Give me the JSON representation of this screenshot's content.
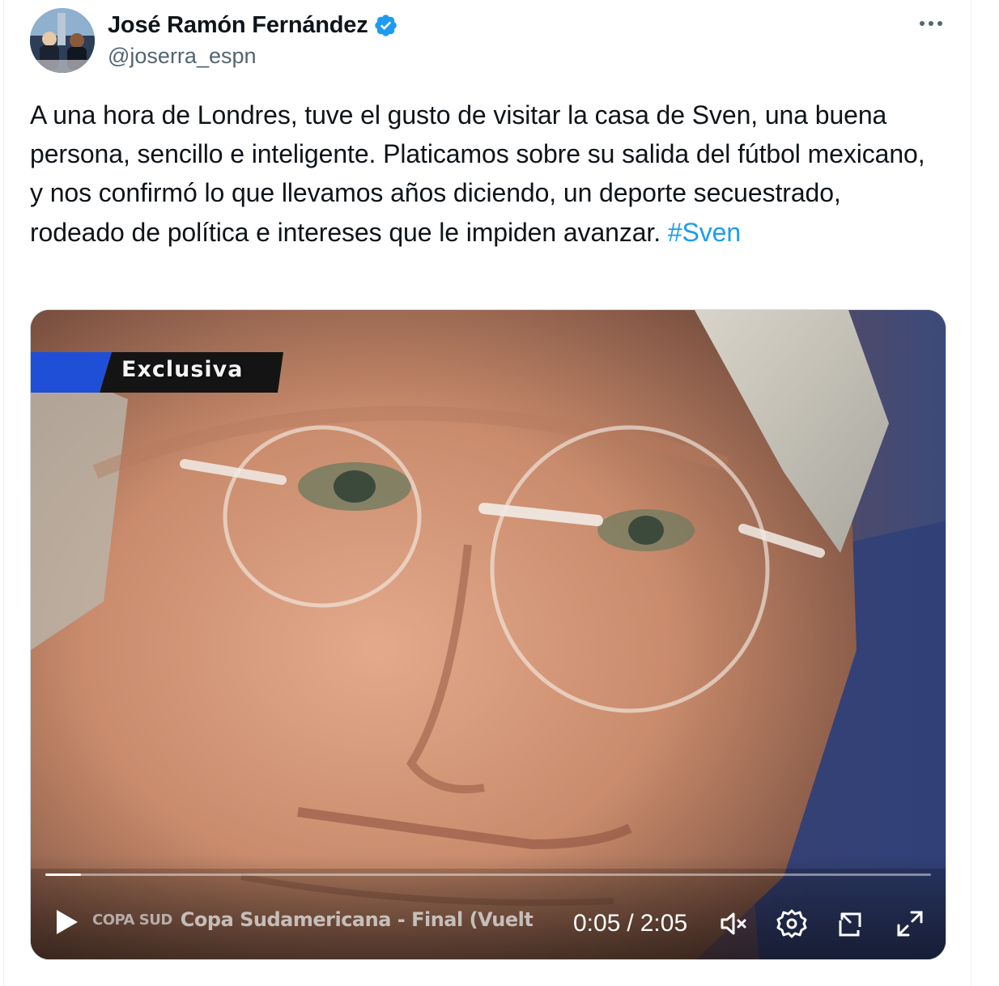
{
  "author": {
    "display_name": "José Ramón Fernández",
    "handle": "@joserra_espn",
    "verified": true,
    "verified_color": "#1d9bf0"
  },
  "tweet": {
    "text": "A una hora de Londres, tuve el gusto de visitar la casa de Sven, una buena persona, sencillo e inteligente. Platicamos sobre su salida del fútbol mexicano, y nos confirmó lo que llevamos años diciendo, un deporte secuestrado, rodeado de política e intereses que le impiden avanzar.",
    "hashtag": "#Sven",
    "hashtag_color": "#1d9bf0"
  },
  "video": {
    "overlay_label": "Exclusiva",
    "lower_third_logo": "COPA SUD",
    "lower_third_text": "Copa Sudamericana - Final (Vuelt",
    "current_time": "0:05",
    "separator": "/",
    "duration": "2:05",
    "progress_fraction": 0.04,
    "icons": [
      "play-icon",
      "volume-muted-icon",
      "settings-icon",
      "picture-in-picture-icon",
      "fullscreen-icon"
    ]
  },
  "menu": {
    "icon": "more-icon"
  }
}
